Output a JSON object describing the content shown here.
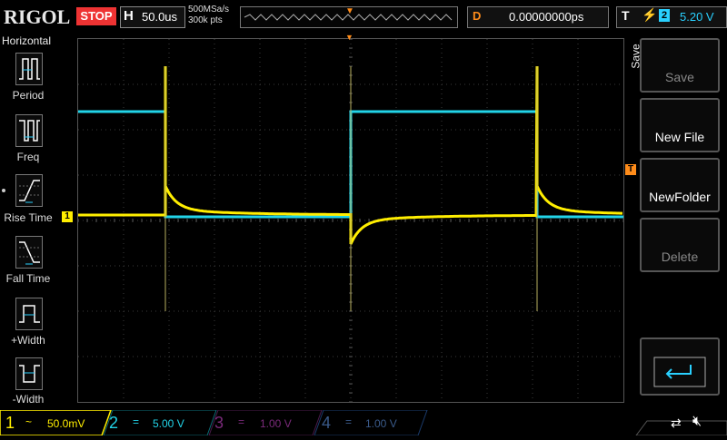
{
  "brand": "RIGOL",
  "run_state": "STOP",
  "timebase": {
    "label": "H",
    "value": "50.0us"
  },
  "sample_rate": "500MSa/s",
  "memory_depth": "300k pts",
  "delay": {
    "label": "D",
    "value": "0.00000000ps"
  },
  "trigger": {
    "type": "T",
    "source": "2",
    "level": "5.20 V",
    "edge_icon": "rising-edge-icon"
  },
  "left_menu": {
    "title": "Horizontal",
    "items": [
      {
        "label": "Period",
        "icon": "period-icon"
      },
      {
        "label": "Freq",
        "icon": "frequency-icon"
      },
      {
        "label": "Rise Time",
        "icon": "rise-time-icon"
      },
      {
        "label": "Fall Time",
        "icon": "fall-time-icon"
      },
      {
        "label": "+Width",
        "icon": "positive-width-icon"
      },
      {
        "label": "-Width",
        "icon": "negative-width-icon"
      }
    ]
  },
  "right_menu": {
    "title": "Save",
    "buttons": [
      {
        "label": "Save",
        "enabled": false
      },
      {
        "label": "New File",
        "enabled": true
      },
      {
        "label": "NewFolder",
        "enabled": true
      },
      {
        "label": "Delete",
        "enabled": false
      },
      {
        "label": "",
        "icon": "return-icon",
        "enabled": true
      }
    ]
  },
  "channels": [
    {
      "num": "1",
      "coupling": "~",
      "scale": "50.0mV",
      "color": "#ffee00",
      "active": true
    },
    {
      "num": "2",
      "coupling": "=",
      "scale": "5.00 V",
      "color": "#22d4e8",
      "active": true
    },
    {
      "num": "3",
      "coupling": "=",
      "scale": "1.00 V",
      "color": "#d31ed3",
      "active": false
    },
    {
      "num": "4",
      "coupling": "=",
      "scale": "1.00 V",
      "color": "#2e7dff",
      "active": false
    }
  ],
  "markers": {
    "ch1": "1",
    "trigger_level": "T"
  },
  "colors": {
    "ch1": "#ffee00",
    "ch2": "#22d4e8",
    "trigger": "#ff8c1a",
    "grid": "#3a3a3a"
  }
}
